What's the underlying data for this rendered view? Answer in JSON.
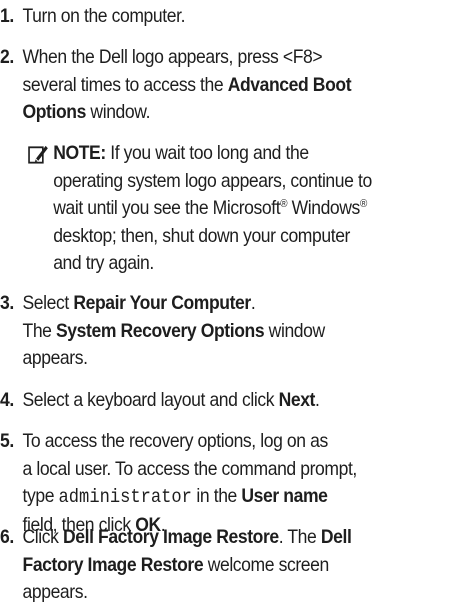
{
  "steps": [
    {
      "number": "1.",
      "lines": [
        "Turn on the computer."
      ]
    },
    {
      "number": "2.",
      "line1": "When the Dell logo appears, press <F8>",
      "line2": "several times to access the ",
      "line2_bold": "Advanced Boot",
      "line3_bold": "Options",
      "line3": " window."
    },
    {
      "number": "3.",
      "line1_prefix": "Select ",
      "line1_bold": "Repair Your Computer",
      "line1_suffix": ".",
      "line2_prefix": "The ",
      "line2_bold": "System Recovery Options",
      "line2_suffix": " window",
      "line3": "appears."
    },
    {
      "number": "4.",
      "prefix": "Select a keyboard layout and click ",
      "bold": "Next",
      "suffix": "."
    },
    {
      "number": "5.",
      "line1": "To access the recovery options, log on as",
      "line2": "a local user. To access the command prompt,",
      "line3_prefix": "type ",
      "line3_code": "administrator",
      "line3_mid": " in the ",
      "line3_bold": "User name",
      "line4_prefix": "field, then click ",
      "line4_bold": "OK",
      "line4_suffix": "."
    },
    {
      "number": "6.",
      "line1_prefix": "Click ",
      "line1_bold": "Dell Factory Image Restore",
      "line1_mid": ". The ",
      "line1_bold2": "Dell",
      "line2_bold": "Factory Image Restore",
      "line2_suffix": " welcome screen",
      "line3": "appears."
    }
  ],
  "note": {
    "icon": "pencil-note-icon",
    "label": "NOTE:",
    "line1": " If you wait too long and the",
    "line2": "operating system logo appears, continue to",
    "line3_prefix": "wait until you see the Microsoft",
    "reg1": "®",
    "line3_mid": " Windows",
    "reg2": "®",
    "line4": "desktop; then, shut down your computer",
    "line5": "and try again."
  }
}
